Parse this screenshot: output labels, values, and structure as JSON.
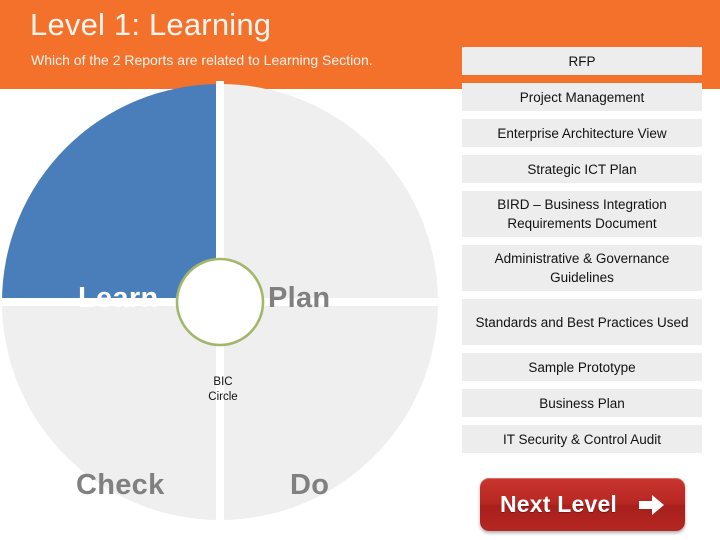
{
  "header": {
    "title": "Level 1: Learning",
    "subtitle": "Which of the 2 Reports are related to Learning Section.",
    "background_color": "#F4712B",
    "text_color": "#FCF5F0"
  },
  "bic_circle": {
    "center_label_line1": "BIC",
    "center_label_line2": "Circle",
    "center_ring_color": "#A3B76A",
    "center_fill_color": "#FFFFFF",
    "quadrants": [
      {
        "label": "Learn",
        "position": "top-left",
        "fill": "#4A7EBB",
        "text_color": "#FFFFFF",
        "selected": true
      },
      {
        "label": "Plan",
        "position": "top-right",
        "fill": "#EFEFEF",
        "text_color": "#808080",
        "selected": false
      },
      {
        "label": "Check",
        "position": "bottom-left",
        "fill": "#EFEFEF",
        "text_color": "#808080",
        "selected": false
      },
      {
        "label": "Do",
        "position": "bottom-right",
        "fill": "#EFEFEF",
        "text_color": "#808080",
        "selected": false
      }
    ]
  },
  "report_list": {
    "item_background": "#EDEDED",
    "items": [
      {
        "label": "RFP",
        "lines": 1
      },
      {
        "label": "Project Management",
        "lines": 1
      },
      {
        "label": "Enterprise Architecture View",
        "lines": 1
      },
      {
        "label": "Strategic ICT Plan",
        "lines": 1
      },
      {
        "label": "BIRD – Business Integration Requirements Document",
        "lines": 2
      },
      {
        "label": "Administrative & Governance Guidelines",
        "lines": 2
      },
      {
        "label": "Standards and Best Practices Used",
        "lines": 2
      },
      {
        "label": "Sample Prototype",
        "lines": 1
      },
      {
        "label": "Business Plan",
        "lines": 1
      },
      {
        "label": "IT Security & Control Audit",
        "lines": 1
      }
    ]
  },
  "next_level_button": {
    "label": "Next Level",
    "icon": "arrow-right-icon",
    "color": "#B72722"
  }
}
